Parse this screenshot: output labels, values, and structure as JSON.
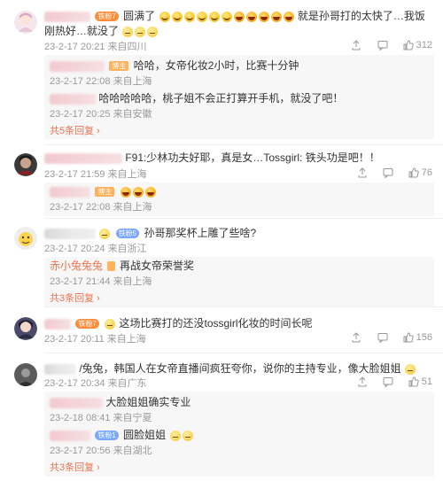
{
  "comments": [
    {
      "text": "圆满了",
      "text2": "就是孙哥打的太快了…我饭",
      "text3": "刚热好…就没了",
      "date": "23-2-17 20:21",
      "location": "来自四川",
      "likes": "312",
      "badge": "铁粉7",
      "replies": [
        {
          "text": "哈哈，女帝化妆2小时，比赛十分钟",
          "date": "23-2-17 22:08",
          "location": "来自上海",
          "badge": "博主"
        },
        {
          "text": "哈哈哈哈哈，桃子姐不会正打算开手机，就没了吧！",
          "date": "23-2-17 20:25",
          "location": "来自安徽"
        }
      ],
      "more": "共5条回复"
    },
    {
      "text": "F91:少林功夫好耶，真是女…Tossgirl: 铁头功是吧！！",
      "date": "23-2-17 21:59",
      "location": "来自上海",
      "likes": "76",
      "replies": [
        {
          "text": "",
          "date": "23-2-17 22:08",
          "location": "来自上海",
          "badge": "博主"
        }
      ]
    },
    {
      "text": "孙哥那奖杯上雕了些啥?",
      "date": "23-2-17 20:24",
      "location": "来自浙江",
      "badge": "铁粉5",
      "replies": [
        {
          "name": "赤小兔兔兔",
          "text": "再战女帝荣誉奖",
          "date": "23-2-17 21:44",
          "location": "来自上海"
        }
      ],
      "more": "共3条回复"
    },
    {
      "text": "这场比赛打的还没tossgirl化妆的时间长呢",
      "date": "23-2-17 20:11",
      "location": "来自上海",
      "likes": "156",
      "badge": "铁粉7"
    },
    {
      "text": "/兔兔，韩国人在女帝直播间疯狂夸你，说你的主持专业，像大脸姐姐",
      "date": "23-2-17 20:34",
      "location": "来自广东",
      "likes": "51",
      "replies": [
        {
          "text": "大脸姐姐确实专业",
          "date": "23-2-18 08:41",
          "location": "来自宁夏"
        },
        {
          "text": "圆脸姐姐",
          "date": "23-2-17 20:56",
          "location": "来自湖北",
          "badge": "铁粉1"
        }
      ],
      "more": "共3条回复"
    }
  ],
  "icons": [
    "share-icon",
    "comment-icon",
    "like-icon"
  ]
}
